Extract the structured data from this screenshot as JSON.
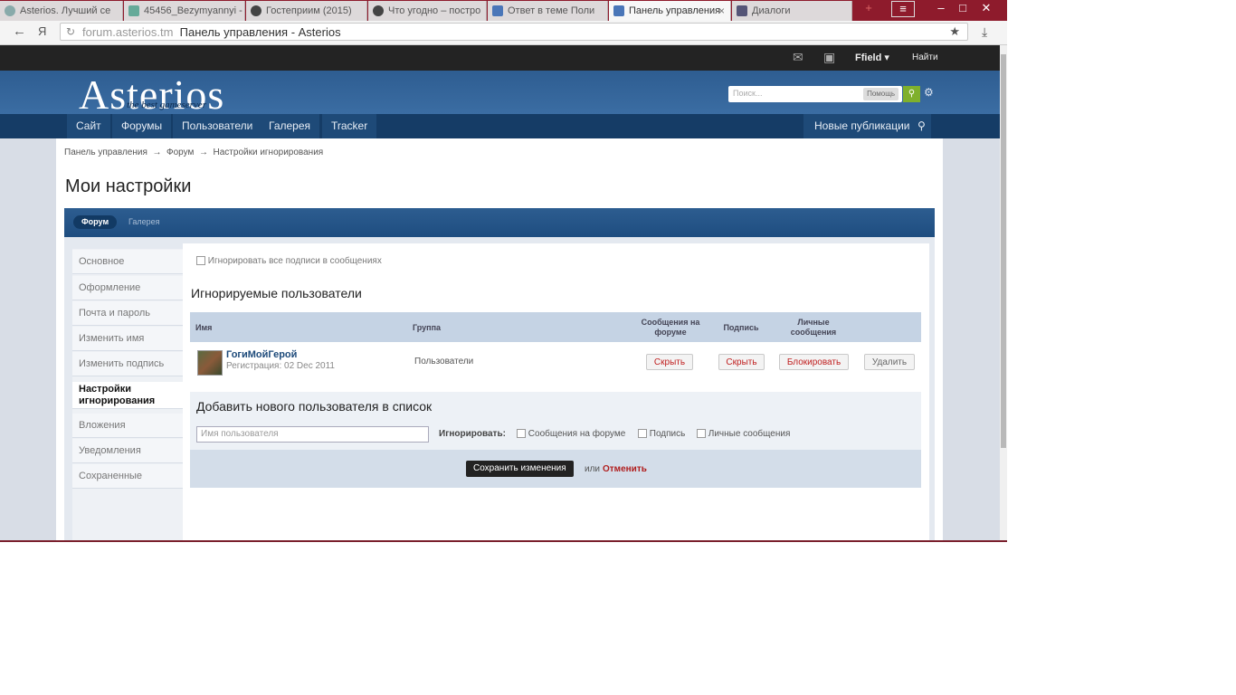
{
  "browser": {
    "tabs": [
      {
        "label": "Asterios. Лучший се",
        "color": "#8aa"
      },
      {
        "label": "45456_Bezymyannyi -",
        "color": "#6a9"
      },
      {
        "label": "Гостеприим (2015)",
        "color": "#444"
      },
      {
        "label": "Что угодно – постро",
        "color": "#444"
      },
      {
        "label": "Ответ в теме Поли",
        "color": "#4a76b8"
      },
      {
        "label": "Панель управления",
        "color": "#4a76b8"
      },
      {
        "label": "Диалоги",
        "color": "#557"
      }
    ],
    "active_tab": 5,
    "back_icon": "←",
    "yandex_icon": "Я",
    "url_domain": "forum.asterios.tm",
    "url_title": "Панель управления - Asterios",
    "download_icon": "⤓",
    "star_icon": "★"
  },
  "site": {
    "user_name": "Ffield",
    "find_label": "Найти",
    "logo_text": "Asterios",
    "logo_tagline": "the best gameserver",
    "search_placeholder": "Поиск...",
    "search_help": "Помощь",
    "nav": [
      "Сайт",
      "Форумы",
      "Пользователи",
      "Галерея",
      "Tracker"
    ],
    "nav_right": "Новые публикации"
  },
  "page": {
    "breadcrumb": [
      "Панель управления",
      "Форум",
      "Настройки игнорирования"
    ],
    "breadcrumb_sep": "→",
    "title": "Мои настройки",
    "tab_forum": "Форум",
    "tab_gallery": "Галерея",
    "sidebar": [
      "Основное",
      "Оформление",
      "Почта и пароль",
      "Изменить имя",
      "Изменить подпись",
      "Настройки игнорирования",
      "Вложения",
      "Уведомления",
      "Сохраненные"
    ],
    "sidebar_active": 5,
    "ignore_all_label": "Игнорировать все подписи в сообщениях",
    "ignored_title": "Игнорируемые пользователи",
    "columns": {
      "name": "Имя",
      "group": "Группа",
      "forum_messages": "Сообщения на форуме",
      "signature": "Подпись",
      "private_messages": "Личные сообщения"
    },
    "row": {
      "user": "ГогиМойГерой",
      "registered": "Регистрация: 02 Dec 2011",
      "group": "Пользователи",
      "btn_forum": "Скрыть",
      "btn_signature": "Скрыть",
      "btn_private": "Блокировать",
      "btn_delete": "Удалить"
    },
    "add_title": "Добавить нового пользователя в список",
    "username_placeholder": "Имя пользователя",
    "ignore_label": "Игнорировать:",
    "opt_forum": "Сообщения на форуме",
    "opt_signature": "Подпись",
    "opt_private": "Личные сообщения",
    "save_label": "Сохранить изменения",
    "or_label": "или",
    "cancel_label": "Отменить"
  }
}
